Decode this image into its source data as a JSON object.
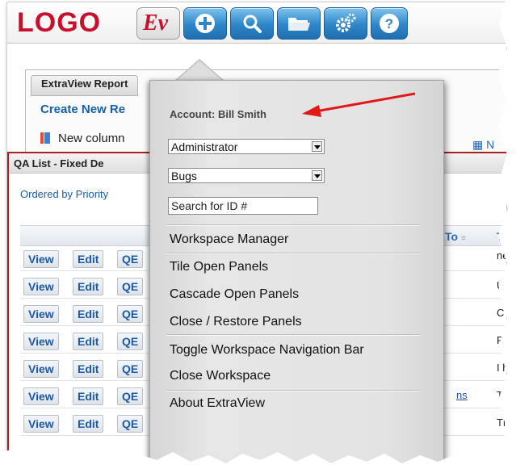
{
  "toolbar": {
    "logo_text": "LOGO",
    "ev_label": "Ev",
    "buttons": [
      {
        "name": "home",
        "icon": "ev-icon"
      },
      {
        "name": "add",
        "icon": "plus-icon"
      },
      {
        "name": "search",
        "icon": "magnifier-icon"
      },
      {
        "name": "folder",
        "icon": "folder-icon"
      },
      {
        "name": "settings",
        "icon": "gears-icon"
      },
      {
        "name": "help",
        "icon": "question-icon"
      }
    ]
  },
  "report_panel": {
    "tab_label": "ExtraView Report",
    "create_link": "Create New Re",
    "new_column_label": "New column",
    "right_icon_label": "N"
  },
  "qa_panel": {
    "title": "QA List - Fixed De",
    "subtitle": "Ordered by Priority",
    "columns": {
      "to": "To",
      "t": "T"
    },
    "rows": [
      {
        "view": "View",
        "edit": "Edit",
        "qe": "QE",
        "text": "ne"
      },
      {
        "view": "View",
        "edit": "Edit",
        "qe": "QE",
        "text": "Us"
      },
      {
        "view": "View",
        "edit": "Edit",
        "qe": "QE",
        "text": "C"
      },
      {
        "view": "View",
        "edit": "Edit",
        "qe": "QE",
        "text": "Pro"
      },
      {
        "view": "View",
        "edit": "Edit",
        "qe": "QE",
        "text": "I ha"
      },
      {
        "view": "View",
        "edit": "Edit",
        "qe": "QE",
        "text": "Th",
        "link": "ns"
      },
      {
        "view": "View",
        "edit": "Edit",
        "qe": "QE",
        "text": "Thi"
      }
    ]
  },
  "menu": {
    "account": "Account: Bill Smith",
    "role_select": "Administrator",
    "area_select": "Bugs",
    "search_placeholder": "Search for ID #",
    "items": {
      "workspace_manager": "Workspace Manager",
      "tile": "Tile Open Panels",
      "cascade": "Cascade Open Panels",
      "close_restore": "Close / Restore Panels",
      "toggle_nav": "Toggle Workspace Navigation Bar",
      "close_workspace": "Close Workspace",
      "about": "About ExtraView"
    }
  },
  "colors": {
    "logo_red": "#c8102e",
    "button_blue": "#2e86c8",
    "link_blue": "#1560a8",
    "arrow_red": "#e01818"
  }
}
